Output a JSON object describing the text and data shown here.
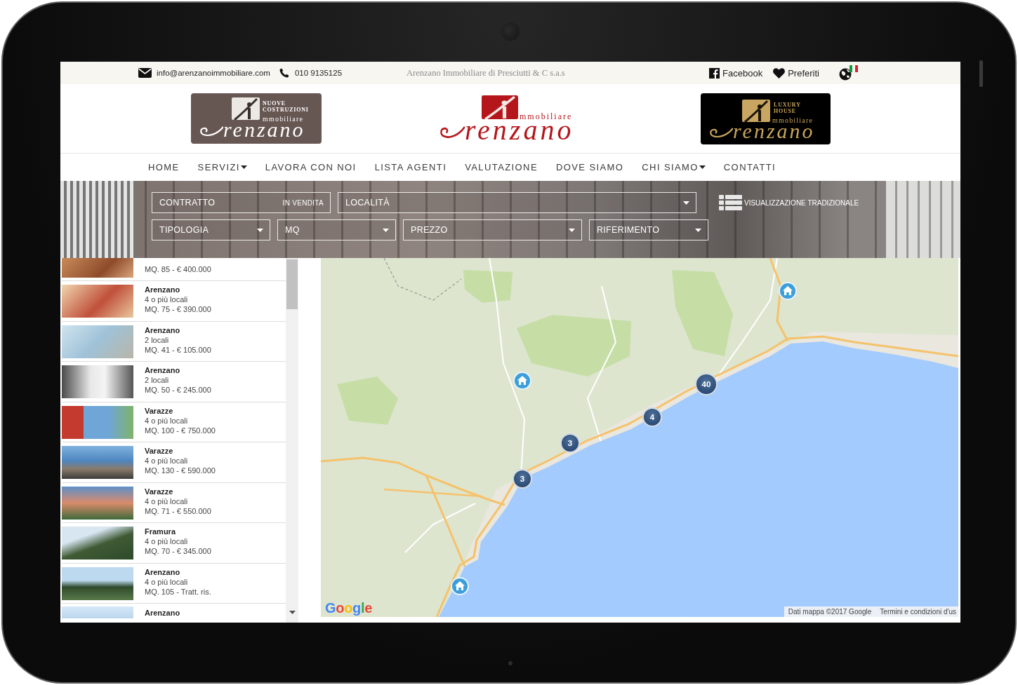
{
  "top_bar": {
    "email": "info@arenzanoimmobiliare.com",
    "phone": "010 9135125",
    "company": "Arenzano Immobiliare di Presciutti & C s.a.s",
    "facebook": "Facebook",
    "favorites": "Preferiti"
  },
  "logos": [
    {
      "kind": "new_builds",
      "tagline": "NUOVE COSTRUZIONI",
      "subtitle": "mmobiliare",
      "wordmark": "renzano"
    },
    {
      "kind": "main",
      "subtitle": "mmobiliare",
      "wordmark": "renzano"
    },
    {
      "kind": "luxury",
      "tagline": "LUXURY HOUSE",
      "subtitle": "mmobiliare",
      "wordmark": "renzano"
    }
  ],
  "nav": [
    {
      "label": "HOME",
      "has_menu": false
    },
    {
      "label": "SERVIZI",
      "has_menu": true
    },
    {
      "label": "LAVORA CON NOI",
      "has_menu": false
    },
    {
      "label": "LISTA AGENTI",
      "has_menu": false
    },
    {
      "label": "VALUTAZIONE",
      "has_menu": false
    },
    {
      "label": "DOVE SIAMO",
      "has_menu": false
    },
    {
      "label": "CHI SIAMO",
      "has_menu": true
    },
    {
      "label": "CONTATTI",
      "has_menu": false
    }
  ],
  "search": {
    "fields": [
      {
        "kind": "value",
        "label": "CONTRATTO",
        "value": "IN VENDITA"
      },
      {
        "kind": "dropdown",
        "label": "LOCALITÀ"
      },
      {
        "kind": "dropdown",
        "label": "TIPOLOGIA"
      },
      {
        "kind": "dropdown",
        "label": "MQ"
      },
      {
        "kind": "dropdown",
        "label": "PREZZO"
      },
      {
        "kind": "dropdown",
        "label": "RIFERIMENTO"
      }
    ],
    "view_toggle": "VISUALIZZAZIONE TRADIZIONALE"
  },
  "listings": [
    {
      "details": "MQ. 85 - € 400.000"
    },
    {
      "city": "Arenzano",
      "rooms": "4 o più locali",
      "details": "MQ. 75 - € 390.000"
    },
    {
      "city": "Arenzano",
      "rooms": "2 locali",
      "details": "MQ. 41 - € 105.000"
    },
    {
      "city": "Arenzano",
      "rooms": "2 locali",
      "details": "MQ. 50 - € 245.000"
    },
    {
      "city": "Varazze",
      "rooms": "4 o più locali",
      "details": "MQ. 100 - € 750.000"
    },
    {
      "city": "Varazze",
      "rooms": "4 o più locali",
      "details": "MQ. 130 - € 590.000"
    },
    {
      "city": "Varazze",
      "rooms": "4 o più locali",
      "details": "MQ. 71 - € 550.000"
    },
    {
      "city": "Framura",
      "rooms": "4 o più locali",
      "details": "MQ. 70 - € 345.000"
    },
    {
      "city": "Arenzano",
      "rooms": "4 o più locali",
      "details": "MQ. 105 - Tratt. ris."
    },
    {
      "city": "Arenzano"
    }
  ],
  "map": {
    "markers": [
      {
        "kind": "pin"
      },
      {
        "kind": "pin"
      },
      {
        "kind": "cluster",
        "count": "40"
      },
      {
        "kind": "cluster",
        "count": "4"
      },
      {
        "kind": "cluster",
        "count": "3"
      },
      {
        "kind": "cluster",
        "count": "3"
      },
      {
        "kind": "pin"
      }
    ],
    "logo": "Google",
    "attribution": "Dati mappa ©2017 Google",
    "terms": "Termini e condizioni d'us"
  }
}
